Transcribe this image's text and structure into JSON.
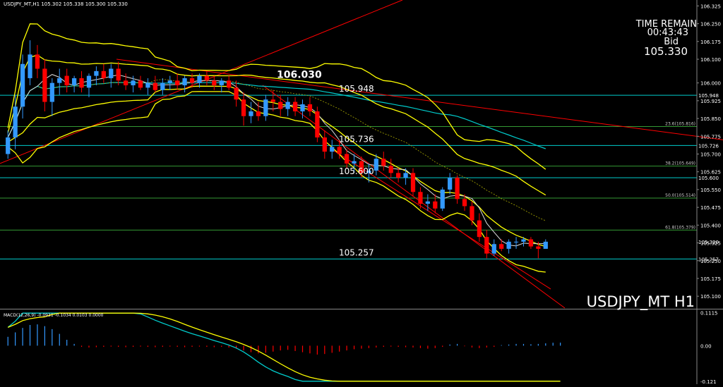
{
  "symbol_header": "USDJPY_MT,H1  105.302 105.338 105.300 105.330",
  "watermark": "USDJPY_MT H1",
  "time_remain": {
    "label": "TIME REMAIN",
    "value": "00:43:43",
    "bid_label": "Bid",
    "bid_value": "105.330"
  },
  "macd_header": "MACD(12,26,9) -0.0931 -0.1034 0.0103 0.0000",
  "colors": {
    "bull": "#3399ff",
    "bear": "#ff0000",
    "band": "#ffff00",
    "ma": "#00cccc",
    "trend": "#ff0000",
    "hline_cyan": "#00cccc",
    "hline_green": "#339933",
    "axis": "#888888"
  },
  "chart_data": [
    {
      "type": "candlestick",
      "title": "USDJPY_MT,H1",
      "ylim": [
        105.05,
        106.35
      ],
      "y_ticks": [
        "106.325",
        "106.250",
        "106.175",
        "106.100",
        "106.000",
        "105.925",
        "105.850",
        "105.775",
        "105.700",
        "105.625",
        "105.550",
        "105.475",
        "105.400",
        "105.325",
        "105.250",
        "105.175",
        "105.100"
      ],
      "y_tick_values": [
        106.325,
        106.25,
        106.175,
        106.1,
        106.0,
        105.925,
        105.85,
        105.775,
        105.7,
        105.625,
        105.55,
        105.475,
        105.4,
        105.325,
        105.25,
        105.175,
        105.1
      ],
      "horizontal_lines": [
        {
          "price": 105.948,
          "label": "105.948",
          "axis_tag": "105.948",
          "color": "cyan"
        },
        {
          "price": 105.736,
          "label": "105.736",
          "axis_tag": "105.726",
          "color": "cyan"
        },
        {
          "price": 105.6,
          "label": "105.600",
          "axis_tag": "105.600",
          "color": "cyan"
        },
        {
          "price": 105.257,
          "label": "105.257",
          "axis_tag": "105.257",
          "color": "cyan"
        }
      ],
      "fib_levels": [
        {
          "label": "23.6(105.816)",
          "price": 105.816
        },
        {
          "label": "38.2(105.649)",
          "price": 105.649
        },
        {
          "label": "50.0(105.514)",
          "price": 105.514
        },
        {
          "label": "61.8(105.379)",
          "price": 105.379
        }
      ],
      "peak_label": "106.030",
      "current_price_tag": "105.330",
      "candles": [
        {
          "o": 105.7,
          "h": 105.8,
          "l": 105.68,
          "c": 105.77
        },
        {
          "o": 105.77,
          "h": 105.95,
          "l": 105.72,
          "c": 105.9
        },
        {
          "o": 105.9,
          "h": 106.12,
          "l": 105.85,
          "c": 106.08
        },
        {
          "o": 106.02,
          "h": 106.18,
          "l": 105.99,
          "c": 106.12
        },
        {
          "o": 106.12,
          "h": 106.16,
          "l": 106.02,
          "c": 106.06
        },
        {
          "o": 106.06,
          "h": 106.1,
          "l": 105.88,
          "c": 105.92
        },
        {
          "o": 105.92,
          "h": 106.02,
          "l": 105.86,
          "c": 106.0
        },
        {
          "o": 106.0,
          "h": 106.06,
          "l": 105.95,
          "c": 106.02
        },
        {
          "o": 106.03,
          "h": 106.06,
          "l": 105.96,
          "c": 105.99
        },
        {
          "o": 105.99,
          "h": 106.03,
          "l": 105.96,
          "c": 106.02
        },
        {
          "o": 106.02,
          "h": 106.05,
          "l": 105.96,
          "c": 105.98
        },
        {
          "o": 105.98,
          "h": 106.04,
          "l": 105.94,
          "c": 106.03
        },
        {
          "o": 106.03,
          "h": 106.07,
          "l": 105.99,
          "c": 106.05
        },
        {
          "o": 106.05,
          "h": 106.08,
          "l": 106.0,
          "c": 106.02
        },
        {
          "o": 106.02,
          "h": 106.08,
          "l": 105.98,
          "c": 106.06
        },
        {
          "o": 106.06,
          "h": 106.09,
          "l": 105.99,
          "c": 106.01
        },
        {
          "o": 106.01,
          "h": 106.04,
          "l": 105.97,
          "c": 105.99
        },
        {
          "o": 105.99,
          "h": 106.03,
          "l": 105.96,
          "c": 106.01
        },
        {
          "o": 106.01,
          "h": 106.03,
          "l": 105.97,
          "c": 105.98
        },
        {
          "o": 105.98,
          "h": 106.02,
          "l": 105.95,
          "c": 106.0
        },
        {
          "o": 106.0,
          "h": 106.03,
          "l": 105.96,
          "c": 105.97
        },
        {
          "o": 105.97,
          "h": 106.02,
          "l": 105.95,
          "c": 106.0
        },
        {
          "o": 106.0,
          "h": 106.03,
          "l": 105.97,
          "c": 106.01
        },
        {
          "o": 106.01,
          "h": 106.04,
          "l": 105.97,
          "c": 105.99
        },
        {
          "o": 105.99,
          "h": 106.03,
          "l": 105.96,
          "c": 106.02
        },
        {
          "o": 106.02,
          "h": 106.04,
          "l": 105.98,
          "c": 106.0
        },
        {
          "o": 106.0,
          "h": 106.04,
          "l": 105.98,
          "c": 106.03
        },
        {
          "o": 106.03,
          "h": 106.05,
          "l": 105.99,
          "c": 106.01
        },
        {
          "o": 106.01,
          "h": 106.03,
          "l": 105.97,
          "c": 105.99
        },
        {
          "o": 105.99,
          "h": 106.02,
          "l": 105.96,
          "c": 106.01
        },
        {
          "o": 106.01,
          "h": 106.03,
          "l": 105.97,
          "c": 105.98
        },
        {
          "o": 105.98,
          "h": 106.01,
          "l": 105.9,
          "c": 105.93
        },
        {
          "o": 105.93,
          "h": 105.96,
          "l": 105.82,
          "c": 105.86
        },
        {
          "o": 105.86,
          "h": 105.92,
          "l": 105.83,
          "c": 105.88
        },
        {
          "o": 105.88,
          "h": 105.92,
          "l": 105.84,
          "c": 105.86
        },
        {
          "o": 105.86,
          "h": 105.95,
          "l": 105.84,
          "c": 105.93
        },
        {
          "o": 105.93,
          "h": 105.97,
          "l": 105.88,
          "c": 105.92
        },
        {
          "o": 105.92,
          "h": 105.95,
          "l": 105.86,
          "c": 105.89
        },
        {
          "o": 105.89,
          "h": 105.94,
          "l": 105.86,
          "c": 105.92
        },
        {
          "o": 105.92,
          "h": 105.94,
          "l": 105.86,
          "c": 105.88
        },
        {
          "o": 105.88,
          "h": 105.93,
          "l": 105.85,
          "c": 105.91
        },
        {
          "o": 105.91,
          "h": 105.94,
          "l": 105.86,
          "c": 105.88
        },
        {
          "o": 105.88,
          "h": 105.9,
          "l": 105.75,
          "c": 105.77
        },
        {
          "o": 105.77,
          "h": 105.8,
          "l": 105.68,
          "c": 105.71
        },
        {
          "o": 105.71,
          "h": 105.76,
          "l": 105.68,
          "c": 105.73
        },
        {
          "o": 105.73,
          "h": 105.76,
          "l": 105.68,
          "c": 105.7
        },
        {
          "o": 105.7,
          "h": 105.72,
          "l": 105.64,
          "c": 105.66
        },
        {
          "o": 105.66,
          "h": 105.7,
          "l": 105.62,
          "c": 105.67
        },
        {
          "o": 105.67,
          "h": 105.69,
          "l": 105.6,
          "c": 105.62
        },
        {
          "o": 105.62,
          "h": 105.66,
          "l": 105.58,
          "c": 105.63
        },
        {
          "o": 105.63,
          "h": 105.7,
          "l": 105.61,
          "c": 105.68
        },
        {
          "o": 105.68,
          "h": 105.71,
          "l": 105.63,
          "c": 105.65
        },
        {
          "o": 105.65,
          "h": 105.68,
          "l": 105.6,
          "c": 105.62
        },
        {
          "o": 105.62,
          "h": 105.64,
          "l": 105.58,
          "c": 105.6
        },
        {
          "o": 105.6,
          "h": 105.64,
          "l": 105.57,
          "c": 105.62
        },
        {
          "o": 105.62,
          "h": 105.64,
          "l": 105.52,
          "c": 105.54
        },
        {
          "o": 105.54,
          "h": 105.56,
          "l": 105.47,
          "c": 105.49
        },
        {
          "o": 105.49,
          "h": 105.53,
          "l": 105.46,
          "c": 105.5
        },
        {
          "o": 105.5,
          "h": 105.53,
          "l": 105.45,
          "c": 105.47
        },
        {
          "o": 105.47,
          "h": 105.56,
          "l": 105.46,
          "c": 105.55
        },
        {
          "o": 105.55,
          "h": 105.62,
          "l": 105.53,
          "c": 105.6
        },
        {
          "o": 105.6,
          "h": 105.61,
          "l": 105.49,
          "c": 105.51
        },
        {
          "o": 105.51,
          "h": 105.53,
          "l": 105.46,
          "c": 105.48
        },
        {
          "o": 105.48,
          "h": 105.5,
          "l": 105.4,
          "c": 105.42
        },
        {
          "o": 105.42,
          "h": 105.45,
          "l": 105.33,
          "c": 105.35
        },
        {
          "o": 105.35,
          "h": 105.38,
          "l": 105.26,
          "c": 105.28
        },
        {
          "o": 105.28,
          "h": 105.34,
          "l": 105.27,
          "c": 105.32
        },
        {
          "o": 105.32,
          "h": 105.34,
          "l": 105.29,
          "c": 105.3
        },
        {
          "o": 105.3,
          "h": 105.34,
          "l": 105.28,
          "c": 105.33
        },
        {
          "o": 105.33,
          "h": 105.35,
          "l": 105.3,
          "c": 105.33
        },
        {
          "o": 105.33,
          "h": 105.35,
          "l": 105.31,
          "c": 105.34
        },
        {
          "o": 105.34,
          "h": 105.35,
          "l": 105.3,
          "c": 105.31
        },
        {
          "o": 105.31,
          "h": 105.33,
          "l": 105.26,
          "c": 105.3
        },
        {
          "o": 105.3,
          "h": 105.34,
          "l": 105.3,
          "c": 105.33
        }
      ]
    },
    {
      "type": "bar",
      "title": "MACD(12,26,9)",
      "ylim": [
        -0.13,
        0.12
      ],
      "y_ticks": [
        "0.1115",
        "0.00",
        "-0.121"
      ],
      "y_tick_values": [
        0.1115,
        0.0,
        -0.121
      ],
      "histogram": [
        0.03,
        0.045,
        0.06,
        0.07,
        0.072,
        0.066,
        0.056,
        0.04,
        0.02,
        0.006,
        -0.004,
        -0.006,
        -0.005,
        -0.004,
        -0.003,
        -0.004,
        -0.005,
        -0.004,
        -0.003,
        -0.004,
        -0.005,
        -0.004,
        -0.003,
        -0.004,
        -0.005,
        -0.004,
        -0.003,
        -0.004,
        -0.005,
        -0.004,
        -0.006,
        -0.01,
        -0.016,
        -0.022,
        -0.026,
        -0.024,
        -0.02,
        -0.016,
        -0.014,
        -0.018,
        -0.022,
        -0.026,
        -0.03,
        -0.028,
        -0.024,
        -0.02,
        -0.016,
        -0.012,
        -0.01,
        -0.008,
        -0.006,
        -0.004,
        -0.003,
        -0.004,
        -0.005,
        -0.006,
        -0.008,
        -0.01,
        -0.008,
        -0.004,
        0.004,
        0.006,
        -0.002,
        -0.006,
        -0.008,
        -0.006,
        -0.004,
        0.002,
        0.004,
        0.006,
        0.006,
        0.005,
        0.006,
        0.008,
        0.01,
        0.0103
      ]
    }
  ]
}
